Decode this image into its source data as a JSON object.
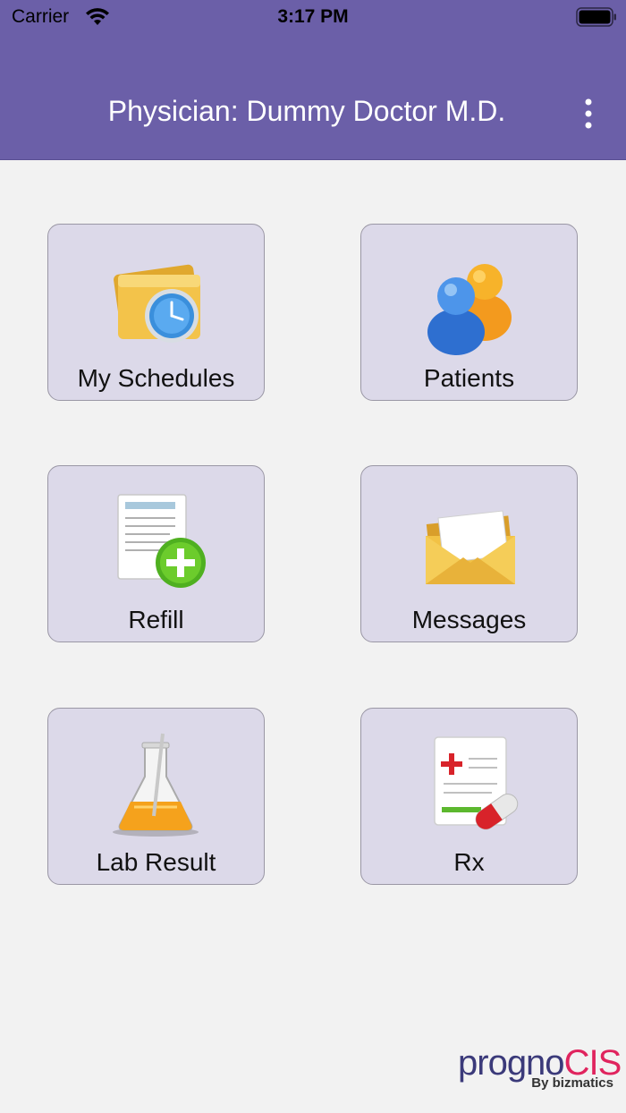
{
  "status_bar": {
    "carrier": "Carrier",
    "time": "3:17 PM"
  },
  "header": {
    "title": "Physician: Dummy Doctor M.D."
  },
  "tiles": [
    {
      "label": "My Schedules",
      "icon": "schedule-folder-clock-icon"
    },
    {
      "label": "Patients",
      "icon": "patients-people-icon"
    },
    {
      "label": "Refill",
      "icon": "refill-document-add-icon"
    },
    {
      "label": "Messages",
      "icon": "messages-envelope-icon"
    },
    {
      "label": "Lab Result",
      "icon": "lab-flask-icon"
    },
    {
      "label": "Rx",
      "icon": "rx-prescription-pill-icon"
    }
  ],
  "logo": {
    "part1": "progno",
    "part2": "CIS",
    "tagline": "By bizmatics"
  },
  "colors": {
    "header": "#6b5fa8",
    "tile_bg": "#dcd9e9",
    "background": "#f2f2f2",
    "logo_primary": "#3b3a7a",
    "logo_accent": "#e0245e"
  }
}
